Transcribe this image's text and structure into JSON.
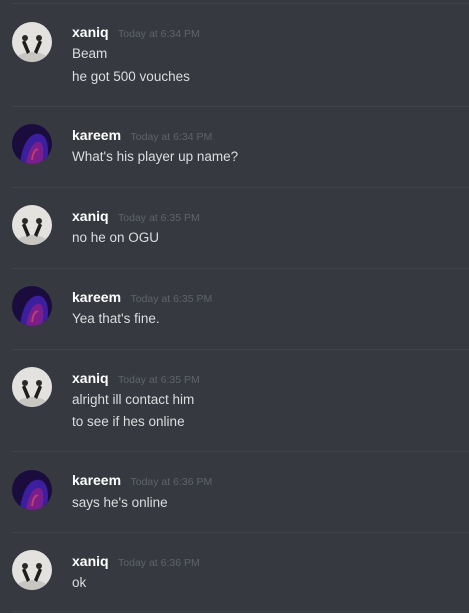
{
  "messages": [
    {
      "author": "xaniq",
      "avatar_icon": "user-avatar-icon",
      "timestamp": "Today at 6:34 PM",
      "lines": [
        "Beam",
        "he got 500 vouches"
      ]
    },
    {
      "author": "kareem",
      "avatar_icon": "user-avatar-icon",
      "timestamp": "Today at 6:34 PM",
      "lines": [
        "What's his player up name?"
      ]
    },
    {
      "author": "xaniq",
      "avatar_icon": "user-avatar-icon",
      "timestamp": "Today at 6:35 PM",
      "lines": [
        "no he on OGU"
      ]
    },
    {
      "author": "kareem",
      "avatar_icon": "user-avatar-icon",
      "timestamp": "Today at 6:35 PM",
      "lines": [
        "Yea that's fine."
      ]
    },
    {
      "author": "xaniq",
      "avatar_icon": "user-avatar-icon",
      "timestamp": "Today at 6:35 PM",
      "lines": [
        "alright ill contact him",
        "to see if hes online"
      ]
    },
    {
      "author": "kareem",
      "avatar_icon": "user-avatar-icon",
      "timestamp": "Today at 6:36 PM",
      "lines": [
        "says he's online"
      ]
    },
    {
      "author": "xaniq",
      "avatar_icon": "user-avatar-icon",
      "timestamp": "Today at 6:36 PM",
      "lines": [
        "ok"
      ]
    }
  ],
  "colors": {
    "background": "#36393f",
    "username": "#ffffff",
    "timestamp": "#5f636b",
    "message_text": "#dcddde",
    "divider": "#40434a"
  }
}
